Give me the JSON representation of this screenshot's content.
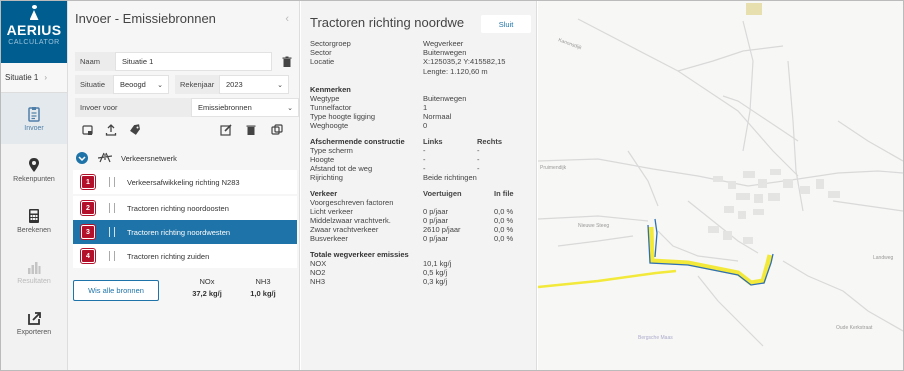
{
  "brand": {
    "name": "AERIUS",
    "sub": "CALCULATOR"
  },
  "nav": {
    "situatie": "Situatie 1",
    "items": [
      {
        "label": "Invoer",
        "icon": "clipboard-icon",
        "state": "active"
      },
      {
        "label": "Rekenpunten",
        "icon": "map-pin-icon",
        "state": "normal"
      },
      {
        "label": "Berekenen",
        "icon": "calculator-icon",
        "state": "normal"
      },
      {
        "label": "Resultaten",
        "icon": "chart-icon",
        "state": "disabled"
      },
      {
        "label": "Exporteren",
        "icon": "export-icon",
        "state": "normal"
      }
    ]
  },
  "panel": {
    "title": "Invoer - Emissiebronnen",
    "naam_label": "Naam",
    "naam_value": "Situatie 1",
    "situatie_label": "Situatie",
    "situatie_value": "Beoogd",
    "rekenjaar_label": "Rekenjaar",
    "rekenjaar_value": "2023",
    "invoer_label": "Invoer voor",
    "invoer_value": "Emissiebronnen",
    "group_label": "Verkeersnetwerk",
    "sources": [
      {
        "num": "1",
        "label": "Verkeersafwikkeling richting N283"
      },
      {
        "num": "2",
        "label": "Tractoren richting noordoosten"
      },
      {
        "num": "3",
        "label": "Tractoren richting noordwesten"
      },
      {
        "num": "4",
        "label": "Tractoren richting zuiden"
      }
    ],
    "all_button": "Wis alle bronnen",
    "totals": [
      {
        "name": "NOx",
        "value": "37,2 kg/j"
      },
      {
        "name": "NH3",
        "value": "1,0 kg/j"
      }
    ]
  },
  "detail": {
    "title": "Tractoren richting noordwe",
    "close": "Sluit",
    "general": [
      {
        "k": "Sectorgroep",
        "v": "Wegverkeer"
      },
      {
        "k": "Sector",
        "v": "Buitenwegen"
      },
      {
        "k": "Locatie",
        "v": "X:125035,2 Y:415582,15"
      }
    ],
    "length": "Lengte: 1.120,60 m",
    "kenmerken_title": "Kenmerken",
    "kenmerken": [
      {
        "k": "Wegtype",
        "v": "Buitenwegen"
      },
      {
        "k": "Tunnelfactor",
        "v": "1"
      },
      {
        "k": "Type hoogte ligging",
        "v": "Normaal"
      },
      {
        "k": "Weghoogte",
        "v": "0"
      }
    ],
    "afsch_title": "Afschermende constructie",
    "afsch_links": "Links",
    "afsch_rechts": "Rechts",
    "afsch": [
      {
        "k": "Type scherm",
        "l": "-",
        "r": "-"
      },
      {
        "k": "Hoogte",
        "l": "-",
        "r": "-"
      },
      {
        "k": "Afstand tot de weg",
        "l": "-",
        "r": "-"
      },
      {
        "k": "Rijrichting",
        "l": "Beide richtingen",
        "r": ""
      }
    ],
    "verkeer_title": "Verkeer",
    "verkeer_col1": "Voertuigen",
    "verkeer_col2": "In file",
    "verkeer_sub": "Voorgeschreven factoren",
    "verkeer": [
      {
        "k": "Licht verkeer",
        "v": "0 p/jaar",
        "f": "0,0 %"
      },
      {
        "k": "Middelzwaar vrachtverk.",
        "v": "0 p/jaar",
        "f": "0,0 %"
      },
      {
        "k": "Zwaar vrachtverkeer",
        "v": "2610 p/jaar",
        "f": "0,0 %"
      },
      {
        "k": "Busverkeer",
        "v": "0 p/jaar",
        "f": "0,0 %"
      }
    ],
    "totaal_title": "Totale wegverkeer emissies",
    "totaal": [
      {
        "k": "NOX",
        "v": "10,1 kg/j"
      },
      {
        "k": "NO2",
        "v": "0,5 kg/j"
      },
      {
        "k": "NH3",
        "v": "0,3 kg/j"
      }
    ]
  },
  "map": {
    "labels": [
      "Kanonsdijk",
      "Pruimendijk",
      "Nieuwe Steeg",
      "Landweg",
      "Oude Kerkstraat",
      "Bergsche Maas"
    ],
    "road_color": "#f2e93a",
    "route_color": "#2f6fb5"
  }
}
